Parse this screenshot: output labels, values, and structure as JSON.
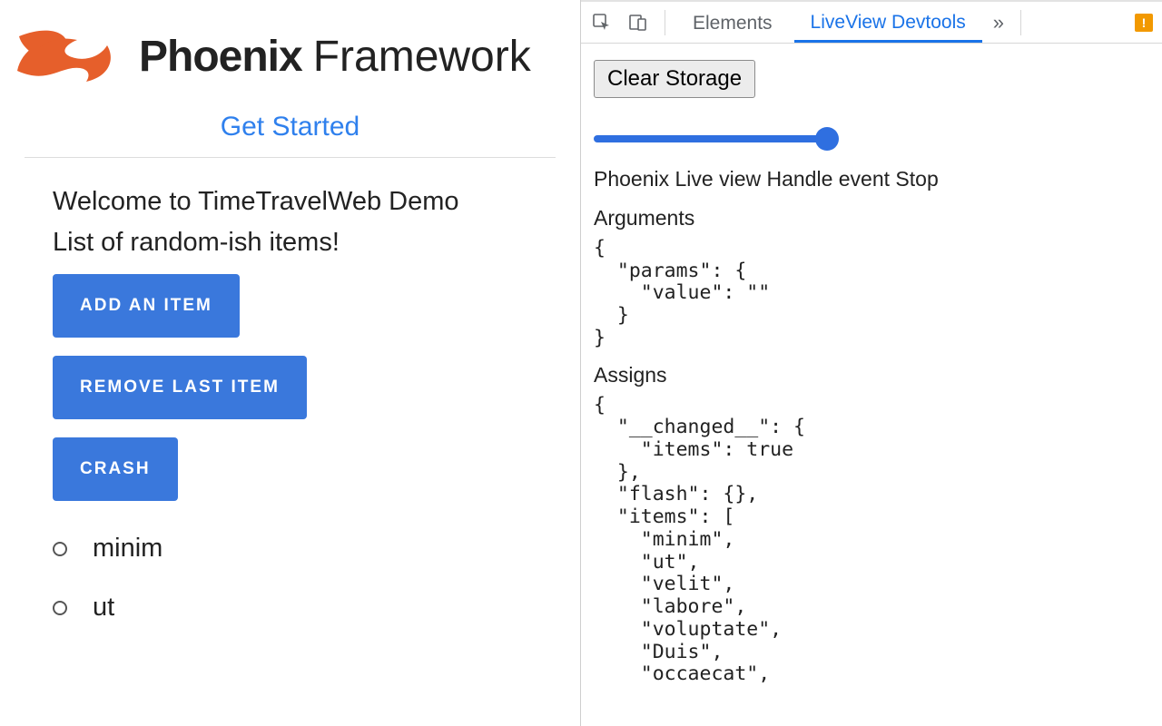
{
  "brand": {
    "bold": "Phoenix",
    "light": "Framework"
  },
  "nav": {
    "get_started_label": "Get Started"
  },
  "page": {
    "title": "Welcome to TimeTravelWeb Demo",
    "subtitle": "List of random-ish items!",
    "buttons": {
      "add": "Add an Item",
      "remove": "Remove Last Item",
      "crash": "Crash"
    },
    "items": [
      "minim",
      "ut"
    ]
  },
  "devtools": {
    "tabs": {
      "elements": "Elements",
      "liveview": "LiveView Devtools",
      "more": "»"
    },
    "clear_storage": "Clear Storage",
    "slider_value": 100,
    "event_name": "Phoenix Live view Handle event Stop",
    "sections": {
      "arguments_label": "Arguments",
      "assigns_label": "Assigns"
    },
    "arguments_json": "{\n  \"params\": {\n    \"value\": \"\"\n  }\n}",
    "assigns_json": "{\n  \"__changed__\": {\n    \"items\": true\n  },\n  \"flash\": {},\n  \"items\": [\n    \"minim\",\n    \"ut\",\n    \"velit\",\n    \"labore\",\n    \"voluptate\",\n    \"Duis\",\n    \"occaecat\","
  }
}
